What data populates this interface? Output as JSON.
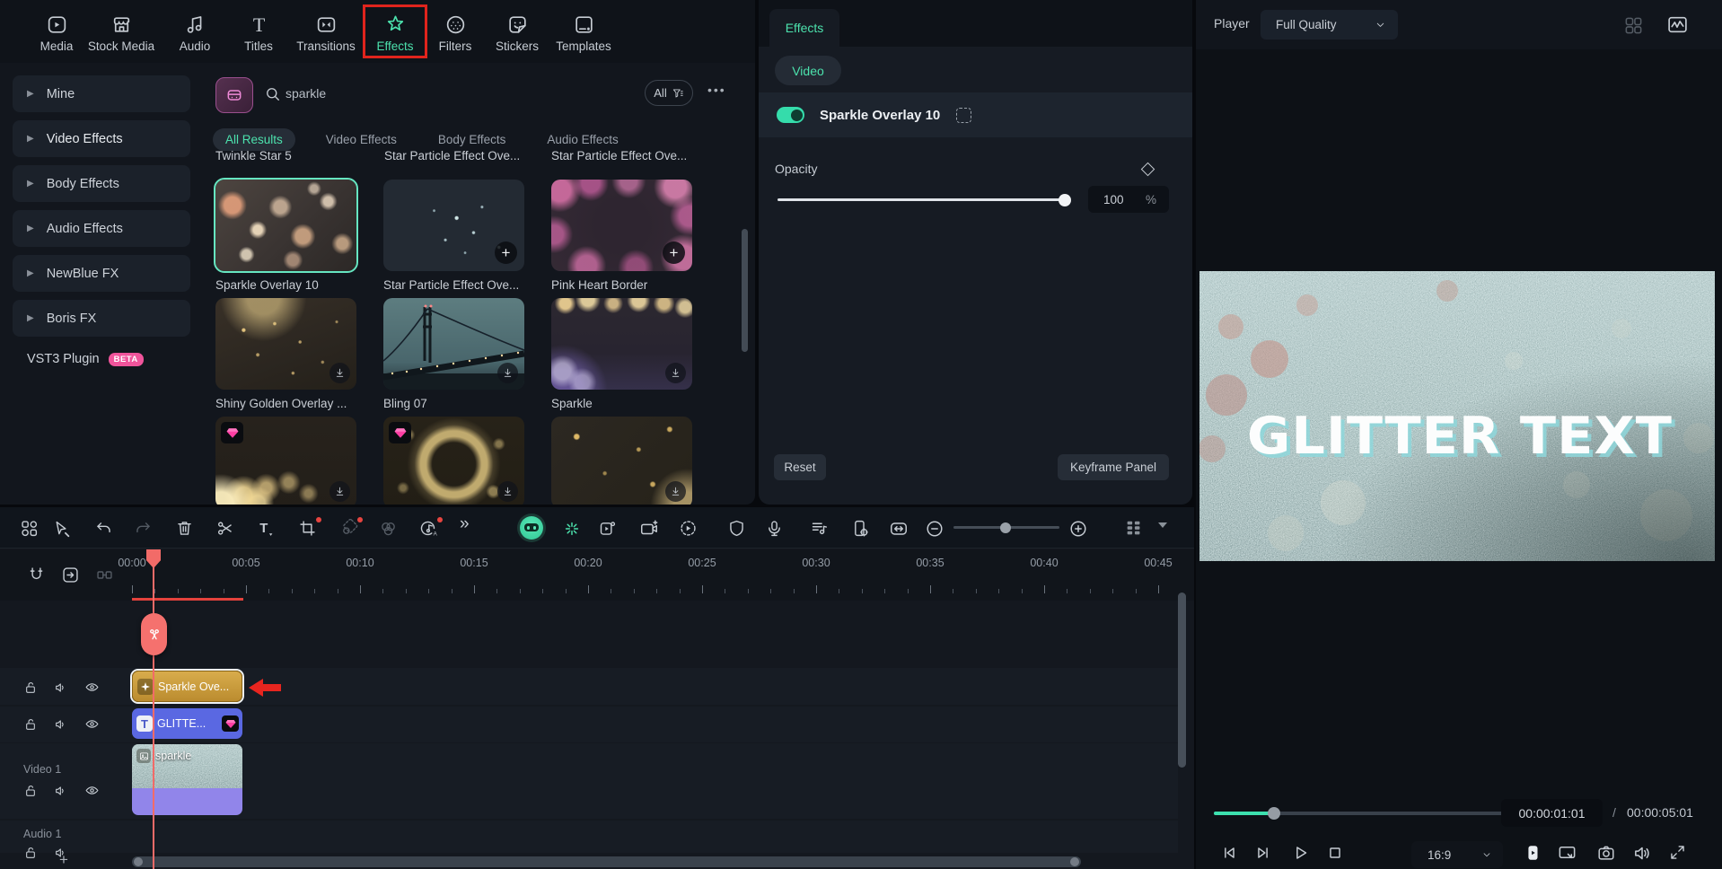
{
  "colors": {
    "accent": "#4ce2ad",
    "annotation_red": "#e0241d",
    "playhead_red": "#f26b68",
    "effect_clip_gold": "#c99c42",
    "text_clip_blue": "#5a68e2",
    "audio_strip_purple": "#9185ea",
    "progress_green": "#3ce0ae"
  },
  "top_nav": {
    "items": [
      {
        "label": "Media"
      },
      {
        "label": "Stock Media"
      },
      {
        "label": "Audio"
      },
      {
        "label": "Titles"
      },
      {
        "label": "Transitions"
      },
      {
        "label": "Effects"
      },
      {
        "label": "Filters"
      },
      {
        "label": "Stickers"
      },
      {
        "label": "Templates"
      }
    ],
    "active": "Effects"
  },
  "sidebar": {
    "items": [
      {
        "label": "Mine"
      },
      {
        "label": "Video Effects"
      },
      {
        "label": "Body Effects"
      },
      {
        "label": "Audio Effects"
      },
      {
        "label": "NewBlue FX"
      },
      {
        "label": "Boris FX"
      },
      {
        "label": "VST3 Plugin",
        "badge": "BETA"
      }
    ]
  },
  "search": {
    "value": "sparkle",
    "filter_label": "All",
    "more_label": "•••"
  },
  "category_tabs": {
    "items": [
      {
        "label": "All Results"
      },
      {
        "label": "Video Effects"
      },
      {
        "label": "Body Effects"
      },
      {
        "label": "Audio Effects"
      }
    ],
    "active": "All Results"
  },
  "effects_grid": {
    "overflow_labels": {
      "a": "Twinkle Star 5",
      "b": "Star Particle Effect Ove...",
      "c": "Star Particle Effect Ove..."
    },
    "items": [
      {
        "name": "Sparkle Overlay 10",
        "selected": true
      },
      {
        "name": "Star Particle Effect Ove..."
      },
      {
        "name": "Pink Heart Border"
      },
      {
        "name": "Shiny Golden Overlay ..."
      },
      {
        "name": "Bling 07"
      },
      {
        "name": "Sparkle"
      }
    ]
  },
  "properties": {
    "tab_label": "Effects",
    "section_label": "Video",
    "effect_name": "Sparkle Overlay 10",
    "opacity_label": "Opacity",
    "opacity_value": "100",
    "opacity_unit": "%",
    "reset_label": "Reset",
    "keyframe_panel_label": "Keyframe Panel"
  },
  "player": {
    "title": "Player",
    "quality": "Full Quality",
    "preview_text": "GLITTER TEXT",
    "current_time": "00:00:01:01",
    "time_separator": "/",
    "total_time": "00:00:05:01",
    "aspect_ratio": "16:9"
  },
  "timeline": {
    "ruler_labels": [
      "00:00",
      "00:05",
      "00:10",
      "00:15",
      "00:20",
      "00:25",
      "00:30",
      "00:35",
      "00:40",
      "00:45"
    ],
    "clips": {
      "effect": "Sparkle Ove...",
      "text": "GLITTE...",
      "video": "sparkle"
    },
    "track_labels": {
      "video": "Video 1",
      "audio": "Audio 1"
    },
    "add_track_label": "+"
  }
}
